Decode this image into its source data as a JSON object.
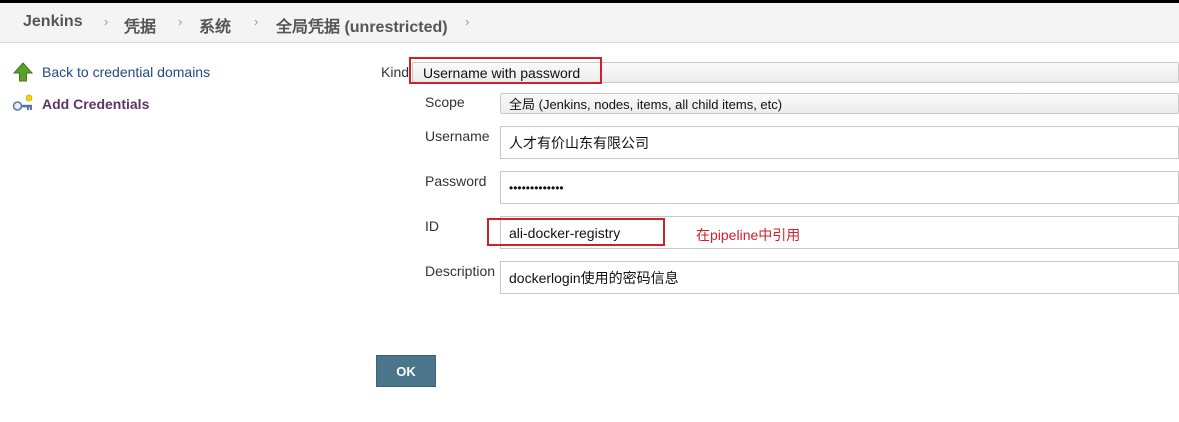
{
  "breadcrumb": {
    "items": [
      "Jenkins",
      "凭据",
      "系统",
      "全局凭据 (unrestricted)"
    ],
    "separator": "›"
  },
  "sidebar": {
    "back_label": "Back to credential domains",
    "add_label": "Add Credentials"
  },
  "form": {
    "kind_label": "Kind",
    "kind_value": "Username with password",
    "scope_label": "Scope",
    "scope_value": "全局 (Jenkins, nodes, items, all child items, etc)",
    "username_label": "Username",
    "username_value": "人才有价山东有限公司",
    "password_label": "Password",
    "password_value": "•••••••••••••",
    "id_label": "ID",
    "id_value": "ali-docker-registry",
    "id_annotation": "在pipeline中引用",
    "description_label": "Description",
    "description_value": "dockerlogin使用的密码信息",
    "ok_label": "OK"
  },
  "colors": {
    "annotation_red": "#d0202a",
    "ok_button": "#4b758b",
    "back_link": "#204a87",
    "add_link": "#5c3566"
  },
  "icons": [
    "up-arrow-icon",
    "key-icon"
  ]
}
